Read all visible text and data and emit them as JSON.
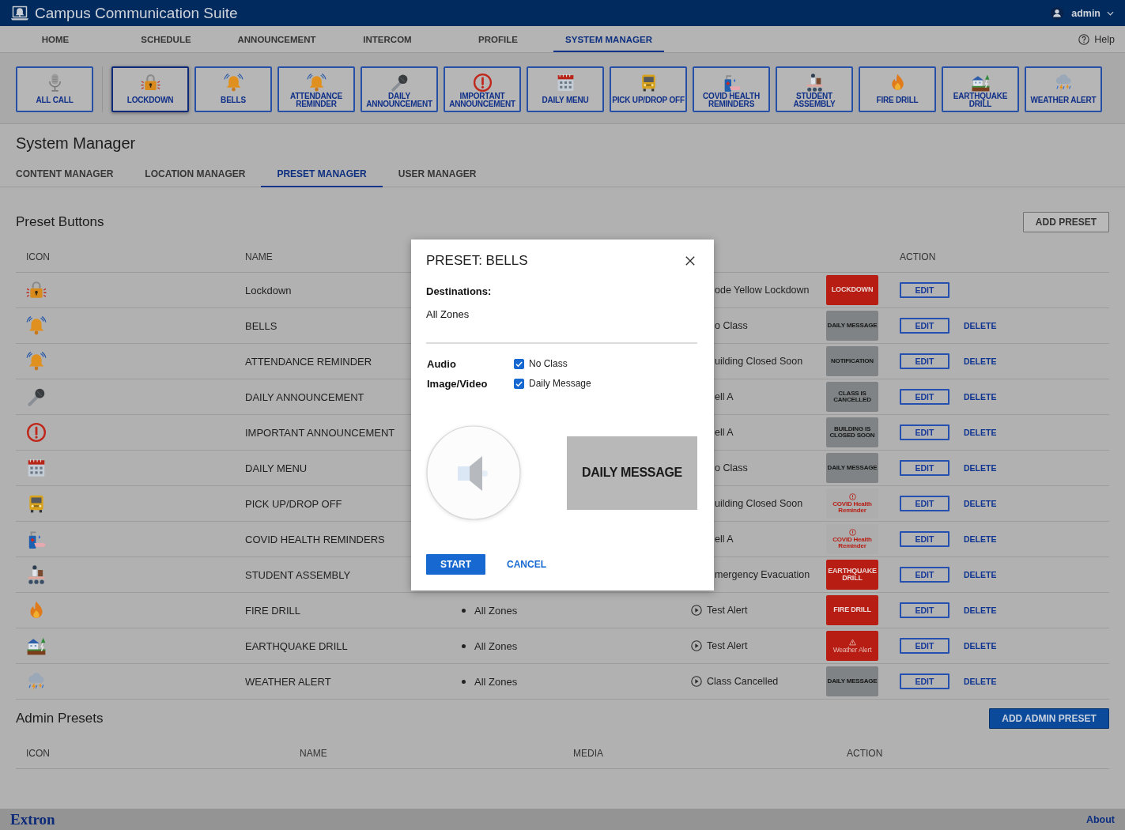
{
  "app": {
    "title": "Campus Communication Suite",
    "user": "admin"
  },
  "nav": {
    "tabs": [
      {
        "label": "HOME",
        "selected": false
      },
      {
        "label": "SCHEDULE",
        "selected": false
      },
      {
        "label": "ANNOUNCEMENT",
        "selected": false
      },
      {
        "label": "INTERCOM",
        "selected": false
      },
      {
        "label": "PROFILE",
        "selected": false
      },
      {
        "label": "SYSTEM MANAGER",
        "selected": true
      }
    ],
    "help": "Help"
  },
  "quick_bar": {
    "all_call": {
      "label": "ALL CALL",
      "selected": false
    },
    "presets": [
      {
        "label": "LOCKDOWN",
        "selected": true
      },
      {
        "label": "BELLS",
        "selected": false
      },
      {
        "label": "ATTENDANCE REMINDER",
        "selected": false
      },
      {
        "label": "DAILY ANNOUNCEMENT",
        "selected": false
      },
      {
        "label": "IMPORTANT ANNOUNCEMENT",
        "selected": false
      },
      {
        "label": "DAILY MENU",
        "selected": false
      },
      {
        "label": "PICK UP/DROP OFF",
        "selected": false
      },
      {
        "label": "COVID HEALTH REMINDERS",
        "selected": false
      },
      {
        "label": "STUDENT ASSEMBLY",
        "selected": false
      },
      {
        "label": "FIRE DRILL",
        "selected": false
      },
      {
        "label": "EARTHQUAKE DRILL",
        "selected": false
      },
      {
        "label": "WEATHER ALERT",
        "selected": false
      }
    ]
  },
  "page": {
    "title": "System Manager",
    "tabs": [
      {
        "label": "CONTENT MANAGER",
        "selected": false
      },
      {
        "label": "LOCATION MANAGER",
        "selected": false
      },
      {
        "label": "PRESET MANAGER",
        "selected": true
      },
      {
        "label": "USER MANAGER",
        "selected": false
      }
    ]
  },
  "preset_buttons": {
    "title": "Preset Buttons",
    "add_button": "ADD PRESET",
    "columns": {
      "icon": "ICON",
      "name": "NAME",
      "action": "ACTION"
    },
    "rows": [
      {
        "name": "Lockdown",
        "audio": "ode Yellow Lockdown",
        "media": {
          "kind": "alert",
          "text": "LOCKDOWN"
        },
        "actions": [
          {
            "label": "EDIT",
            "kind": "button"
          }
        ]
      },
      {
        "name": "BELLS",
        "audio": "o Class",
        "media": {
          "kind": "message",
          "text": "DAILY MESSAGE"
        },
        "actions": [
          {
            "label": "EDIT",
            "kind": "button"
          },
          {
            "label": "DELETE",
            "kind": "link"
          }
        ]
      },
      {
        "name": "ATTENDANCE REMINDER",
        "audio": "uilding Closed Soon",
        "media": {
          "kind": "message",
          "text": "NOTIFICATION"
        },
        "actions": [
          {
            "label": "EDIT",
            "kind": "button"
          },
          {
            "label": "DELETE",
            "kind": "link"
          }
        ]
      },
      {
        "name": "DAILY ANNOUNCEMENT",
        "audio": "ell A",
        "media": {
          "kind": "message",
          "text": "CLASS IS CANCELLED"
        },
        "actions": [
          {
            "label": "EDIT",
            "kind": "button"
          },
          {
            "label": "DELETE",
            "kind": "link"
          }
        ]
      },
      {
        "name": "IMPORTANT ANNOUNCEMENT",
        "audio": "ell A",
        "media": {
          "kind": "message",
          "text": "BUILDING IS CLOSED SOON"
        },
        "actions": [
          {
            "label": "EDIT",
            "kind": "button"
          },
          {
            "label": "DELETE",
            "kind": "link"
          }
        ]
      },
      {
        "name": "DAILY MENU",
        "audio": "o Class",
        "media": {
          "kind": "message",
          "text": "DAILY MESSAGE"
        },
        "actions": [
          {
            "label": "EDIT",
            "kind": "button"
          },
          {
            "label": "DELETE",
            "kind": "link"
          }
        ]
      },
      {
        "name": "PICK UP/DROP OFF",
        "audio": "uilding Closed Soon",
        "media": {
          "kind": "reminder",
          "text": "COVID Health Reminder"
        },
        "actions": [
          {
            "label": "EDIT",
            "kind": "button"
          },
          {
            "label": "DELETE",
            "kind": "link"
          }
        ]
      },
      {
        "name": "COVID HEALTH REMINDERS",
        "audio": "ell A",
        "media": {
          "kind": "reminder",
          "text": "COVID Health Reminder"
        },
        "actions": [
          {
            "label": "EDIT",
            "kind": "button"
          },
          {
            "label": "DELETE",
            "kind": "link"
          }
        ]
      },
      {
        "name": "STUDENT ASSEMBLY",
        "audio": "mergency Evacuation",
        "media": {
          "kind": "alert",
          "text": "EARTHQUAKE DRILL"
        },
        "actions": [
          {
            "label": "EDIT",
            "kind": "button"
          },
          {
            "label": "DELETE",
            "kind": "link"
          }
        ]
      },
      {
        "name": "FIRE DRILL",
        "destination": "All Zones",
        "audio": "Test Alert",
        "media": {
          "kind": "alert",
          "text": "FIRE DRILL"
        },
        "actions": [
          {
            "label": "EDIT",
            "kind": "button"
          },
          {
            "label": "DELETE",
            "kind": "link"
          }
        ]
      },
      {
        "name": "EARTHQUAKE DRILL",
        "destination": "All Zones",
        "audio": "Test Alert",
        "media": {
          "kind": "warning",
          "text": "Weather Alert"
        },
        "actions": [
          {
            "label": "EDIT",
            "kind": "button"
          },
          {
            "label": "DELETE",
            "kind": "link"
          }
        ]
      },
      {
        "name": "WEATHER ALERT",
        "destination": "All Zones",
        "audio": "Class Cancelled",
        "media": {
          "kind": "message",
          "text": "DAILY MESSAGE"
        },
        "actions": [
          {
            "label": "EDIT",
            "kind": "button"
          },
          {
            "label": "DELETE",
            "kind": "link"
          }
        ]
      }
    ]
  },
  "admin_presets": {
    "title": "Admin Presets",
    "add_button": "ADD ADMIN PRESET",
    "columns": [
      "ICON",
      "NAME",
      "MEDIA",
      "ACTION"
    ]
  },
  "dialog": {
    "title": "PRESET: BELLS",
    "destinations_label": "Destinations:",
    "destinations": "All Zones",
    "media": [
      {
        "label": "Audio",
        "item": "No Class",
        "checked": true
      },
      {
        "label": "Image/Video",
        "item": "Daily Message",
        "checked": true
      }
    ],
    "preview": "DAILY MESSAGE",
    "start": "START",
    "cancel": "CANCEL"
  },
  "footer": {
    "brand": "Extron",
    "about": "About"
  }
}
